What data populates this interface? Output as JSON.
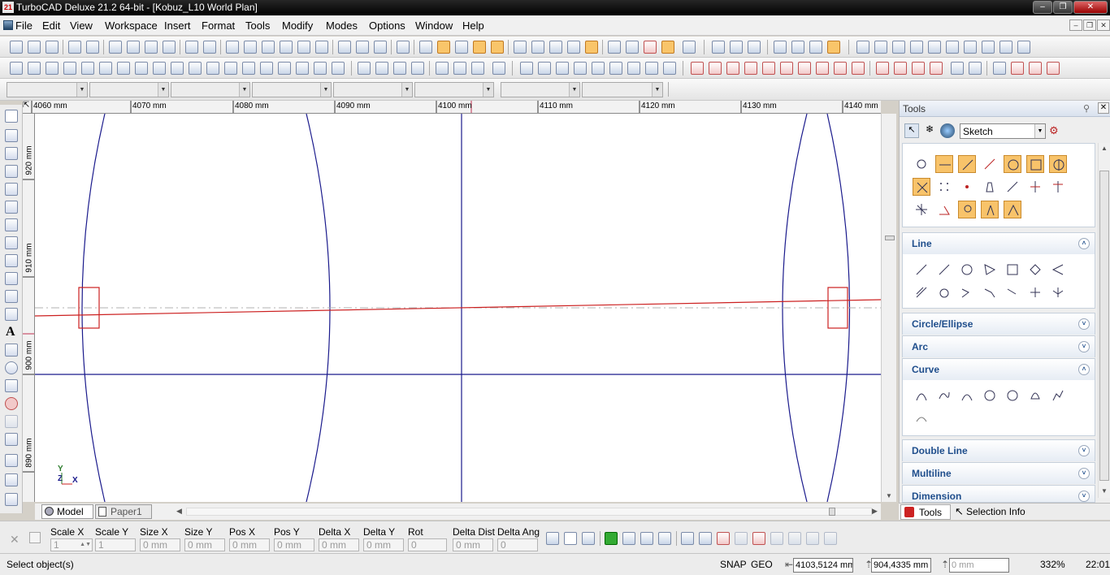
{
  "window": {
    "title": "TurboCAD Deluxe 21.2 64-bit - [Kobuz_L10 World Plan]",
    "app_icon_text": "21"
  },
  "menu": {
    "items": [
      "File",
      "Edit",
      "View",
      "Workspace",
      "Insert",
      "Format",
      "Tools",
      "Modify",
      "Modes",
      "Options",
      "Window",
      "Help"
    ]
  },
  "rulers": {
    "horizontal_labels": [
      "4060 mm",
      "4070 mm",
      "4080 mm",
      "4090 mm",
      "4100 mm",
      "4110 mm",
      "4120 mm",
      "4130 mm",
      "4140 mm"
    ],
    "vertical_labels": [
      "920 mm",
      "910 mm",
      "900 mm",
      "890 mm"
    ]
  },
  "axis_indicator": {
    "y": "Y",
    "z": "Z",
    "x": "X"
  },
  "tabs": {
    "model": "Model",
    "paper": "Paper1"
  },
  "tools_panel": {
    "title": "Tools",
    "mode_select": "Sketch",
    "sections": [
      {
        "label": "Line",
        "state": "expanded"
      },
      {
        "label": "Circle/Ellipse",
        "state": "collapsed"
      },
      {
        "label": "Arc",
        "state": "collapsed"
      },
      {
        "label": "Curve",
        "state": "expanded"
      },
      {
        "label": "Double Line",
        "state": "collapsed"
      },
      {
        "label": "Multiline",
        "state": "collapsed"
      },
      {
        "label": "Dimension",
        "state": "collapsed"
      }
    ],
    "bottom_tabs": {
      "tools": "Tools",
      "selection_info": "Selection Info"
    }
  },
  "inspector": {
    "fields": [
      {
        "label": "Scale X",
        "value": "1"
      },
      {
        "label": "Scale Y",
        "value": "1"
      },
      {
        "label": "Size X",
        "value": "0 mm"
      },
      {
        "label": "Size Y",
        "value": "0 mm"
      },
      {
        "label": "Pos X",
        "value": "0 mm"
      },
      {
        "label": "Pos Y",
        "value": "0 mm"
      },
      {
        "label": "Delta X",
        "value": "0 mm"
      },
      {
        "label": "Delta Y",
        "value": "0 mm"
      },
      {
        "label": "Rot",
        "value": "0"
      },
      {
        "label": "Delta Dist",
        "value": "0 mm"
      },
      {
        "label": "Delta Ang",
        "value": "0"
      }
    ]
  },
  "status": {
    "prompt": "Select object(s)",
    "snap": "SNAP",
    "geo": "GEO",
    "x_value": "4103,5124 mm",
    "y_value": "904,4335 mm",
    "z_value": "0 mm",
    "zoom": "332%",
    "time": "22:01"
  },
  "colors": {
    "geometry_blue": "#1a1a8c",
    "geometry_red": "#cc2020",
    "highlight_orange": "#f8c36a",
    "section_header_text": "#1f4e8c"
  }
}
